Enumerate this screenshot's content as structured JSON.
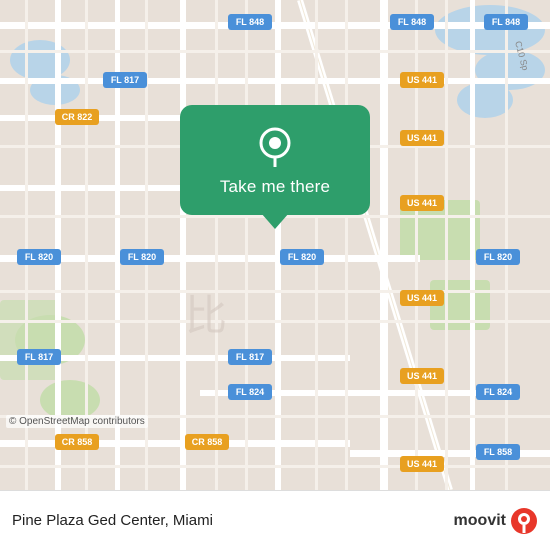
{
  "map": {
    "attribution": "© OpenStreetMap contributors",
    "background_color": "#e8e0d8",
    "road_color": "#ffffff",
    "water_color": "#b8d4e8",
    "green_color": "#c8ddb0"
  },
  "popup": {
    "button_label": "Take me there",
    "background_color": "#2e9e6b"
  },
  "bottom_bar": {
    "location_name": "Pine Plaza Ged Center, Miami",
    "brand_name": "moovit"
  },
  "road_labels": [
    "FL 848",
    "FL 848",
    "FL 848",
    "FL 817",
    "FL 817",
    "FL 817",
    "CR 822",
    "US 441",
    "US 441",
    "US 441",
    "US 441",
    "FL 820",
    "FL 820",
    "FL 820",
    "FL 824",
    "FL 824",
    "CR 858",
    "CR 858",
    "FL 858",
    "C10 Sp"
  ]
}
